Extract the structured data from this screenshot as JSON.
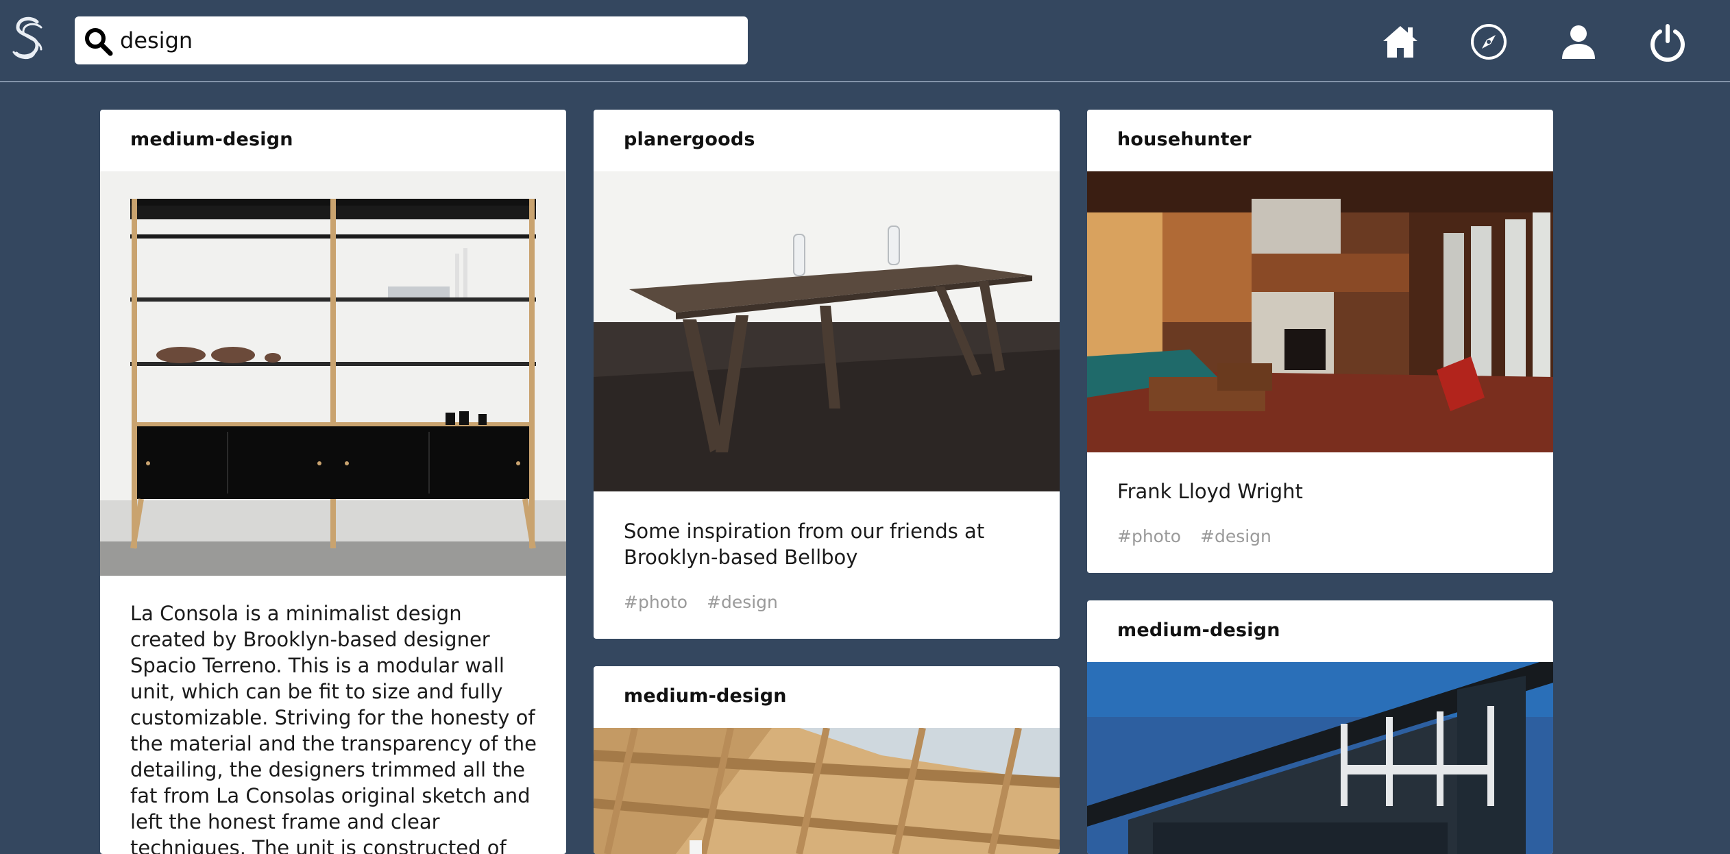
{
  "search": {
    "value": "design"
  },
  "nav": {
    "home_icon": "home-icon",
    "explore_icon": "compass-icon",
    "profile_icon": "user-icon",
    "logout_icon": "power-icon"
  },
  "cards": [
    {
      "user": "medium-design",
      "image_subject": "black and wood modular shelving unit",
      "caption": "La Consola is a minimalist design created by Brooklyn-based designer Spacio Terreno. This is a modular wall unit, which can be fit to size and fully customizable. Striving for the honesty of the material and the transparency of the detailing, the designers trimmed all the fat from La Consolas original sketch and left the honest frame and clear techniques. The unit is constructed of Black Finply, brass, and steel hardware"
    },
    {
      "user": "planergoods",
      "image_subject": "long wooden dining table with oil lamps",
      "caption": "Some inspiration from our friends at Brooklyn-based Bellboy",
      "tags": [
        "#photo",
        "#design"
      ]
    },
    {
      "user": "medium-design",
      "image_subject": "wooden roof beams and skylights"
    },
    {
      "user": "househunter",
      "image_subject": "mid-century living room interior",
      "caption": "Frank Lloyd Wright",
      "tags": [
        "#photo",
        "#design"
      ]
    },
    {
      "user": "medium-design",
      "image_subject": "modern house exterior against blue sky"
    }
  ],
  "colors": {
    "background": "#34475f",
    "card": "#ffffff",
    "tag": "#9a9a9a"
  }
}
